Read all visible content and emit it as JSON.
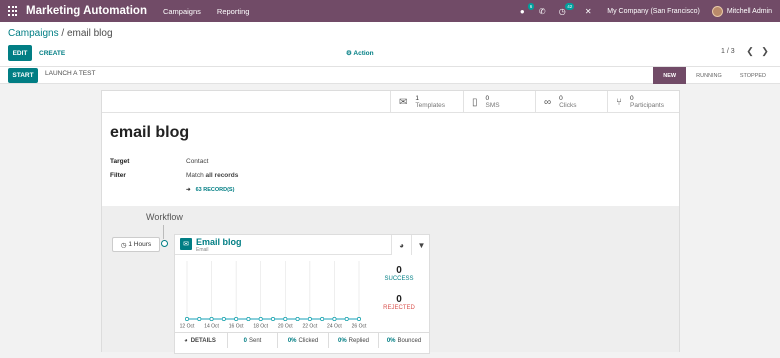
{
  "app": {
    "title": "Marketing Automation",
    "menu": [
      "Campaigns",
      "Reporting"
    ],
    "badges": {
      "chat": "6",
      "activity": "42"
    },
    "company": "My Company (San Francisco)",
    "user": "Mitchell Admin"
  },
  "breadcrumb": {
    "parent": "Campaigns",
    "separator": " / ",
    "current": "email blog"
  },
  "toolbar": {
    "edit": "EDIT",
    "create": "CREATE",
    "action": "Action",
    "pager": "1 / 3"
  },
  "statusbar": {
    "start": "START",
    "launch": "LAUNCH A TEST",
    "stages": [
      "NEW",
      "RUNNING",
      "STOPPED"
    ],
    "active_stage": "NEW"
  },
  "stats": [
    {
      "icon": "envelope-icon",
      "count": "1",
      "label": "Templates"
    },
    {
      "icon": "mobile-icon",
      "count": "0",
      "label": "SMS"
    },
    {
      "icon": "link-icon",
      "count": "0",
      "label": "Clicks"
    },
    {
      "icon": "users-icon",
      "count": "0",
      "label": "Participants"
    }
  ],
  "form": {
    "title": "email blog",
    "target_label": "Target",
    "target_value": "Contact",
    "filter_label": "Filter",
    "filter_prefix": "Match ",
    "filter_value": "all records",
    "records": "63 RECORD(S)"
  },
  "workflow": {
    "title": "Workflow",
    "interval": "1 Hours",
    "activity": {
      "name": "Email blog",
      "type": "Email",
      "success_count": "0",
      "success_label": "SUCCESS",
      "rejected_count": "0",
      "rejected_label": "REJECTED",
      "details": "DETAILS",
      "sent": {
        "value": "0",
        "label": "Sent"
      },
      "clicked": {
        "value": "0%",
        "label": "Clicked"
      },
      "replied": {
        "value": "0%",
        "label": "Replied"
      },
      "bounced": {
        "value": "0%",
        "label": "Bounced"
      }
    }
  },
  "colors": {
    "brand": "#714b67",
    "accent": "#017e84",
    "success": "#28a745",
    "danger": "#d9534f"
  },
  "chart_data": {
    "type": "line",
    "x": [
      "12 Oct",
      "13 Oct",
      "14 Oct",
      "15 Oct",
      "16 Oct",
      "17 Oct",
      "18 Oct",
      "19 Oct",
      "20 Oct",
      "21 Oct",
      "22 Oct",
      "23 Oct",
      "24 Oct",
      "25 Oct",
      "26 Oct"
    ],
    "tick_labels": [
      "12 Oct",
      "14 Oct",
      "16 Oct",
      "18 Oct",
      "20 Oct",
      "22 Oct",
      "24 Oct",
      "26 Oct"
    ],
    "series": [
      {
        "values": [
          0,
          0,
          0,
          0,
          0,
          0,
          0,
          0,
          0,
          0,
          0,
          0,
          0,
          0,
          0
        ],
        "color": "#28a745"
      },
      {
        "values": [
          0,
          0,
          0,
          0,
          0,
          0,
          0,
          0,
          0,
          0,
          0,
          0,
          0,
          0,
          0
        ],
        "color": "#17a2b8"
      }
    ],
    "grid": true
  }
}
